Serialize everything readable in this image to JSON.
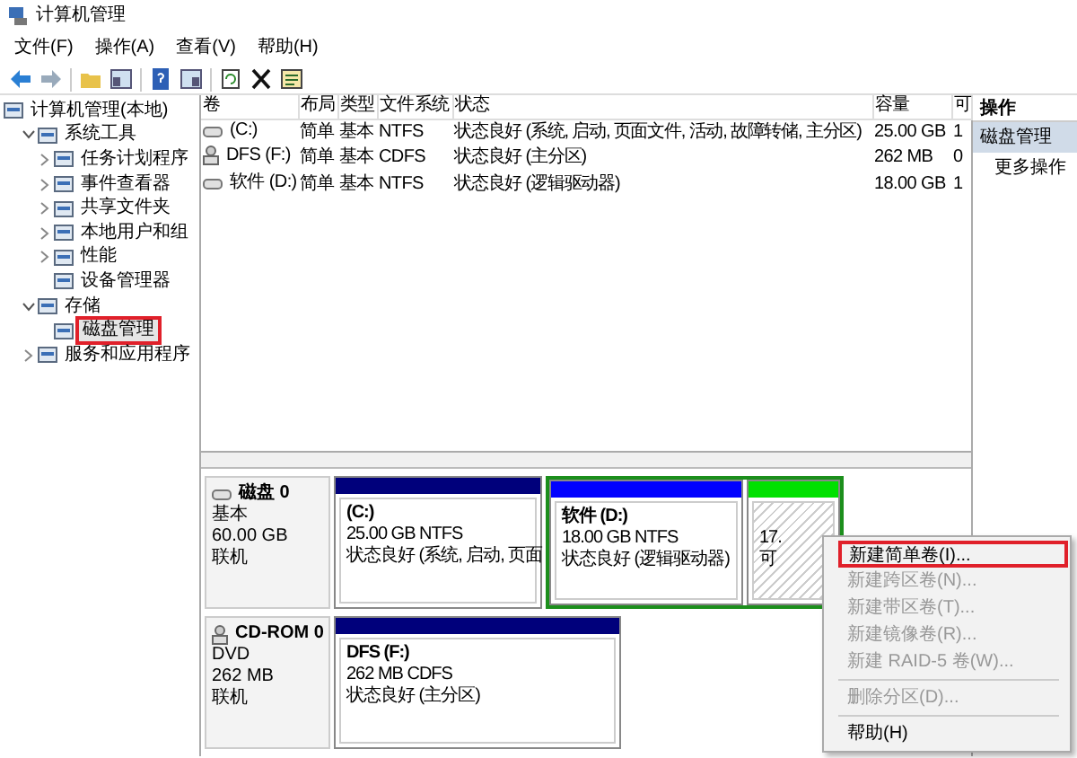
{
  "window": {
    "title": "计算机管理"
  },
  "menu": [
    "文件(F)",
    "操作(A)",
    "查看(V)",
    "帮助(H)"
  ],
  "tree": [
    {
      "label": "计算机管理(本地)",
      "selected": false,
      "highlighted": false,
      "children": [
        {
          "label": "系统工具",
          "expanded": true,
          "selected": false,
          "highlighted": false,
          "children": [
            {
              "label": "任务计划程序",
              "expanded": false,
              "selected": false,
              "highlighted": false
            },
            {
              "label": "事件查看器",
              "expanded": false,
              "selected": false,
              "highlighted": false
            },
            {
              "label": "共享文件夹",
              "expanded": false,
              "selected": false,
              "highlighted": false
            },
            {
              "label": "本地用户和组",
              "expanded": false,
              "selected": false,
              "highlighted": false
            },
            {
              "label": "性能",
              "expanded": false,
              "selected": false,
              "highlighted": false
            },
            {
              "label": "设备管理器",
              "selected": false,
              "highlighted": false
            }
          ]
        },
        {
          "label": "存储",
          "expanded": true,
          "selected": false,
          "highlighted": false,
          "children": [
            {
              "label": "磁盘管理",
              "selected": true,
              "highlighted": true
            }
          ]
        },
        {
          "label": "服务和应用程序",
          "expanded": false,
          "selected": false,
          "highlighted": false
        }
      ]
    }
  ],
  "table": {
    "columns": [
      "卷",
      "布局",
      "类型",
      "文件系统",
      "状态",
      "容量",
      "可"
    ],
    "rows": [
      {
        "kind": "hdd",
        "cells": [
          "(C:)",
          "简单",
          "基本",
          "NTFS",
          "状态良好 (系统, 启动, 页面文件, 活动, 故障转储, 主分区)",
          "25.00 GB",
          "1"
        ]
      },
      {
        "kind": "cdrom",
        "cells": [
          "DFS (F:)",
          "简单",
          "基本",
          "CDFS",
          "状态良好 (主分区)",
          "262 MB",
          "0"
        ]
      },
      {
        "kind": "hdd",
        "cells": [
          "软件 (D:)",
          "简单",
          "基本",
          "NTFS",
          "状态良好 (逻辑驱动器)",
          "18.00 GB",
          "1"
        ]
      }
    ]
  },
  "disks": [
    {
      "kind": "hdd",
      "name": "磁盘 0",
      "lines": [
        "基本",
        "60.00 GB",
        "联机"
      ],
      "partitions": [
        {
          "kind": "primary",
          "color": "#00007b",
          "name": "(C:)",
          "lines": [
            "25.00 GB NTFS",
            "状态良好 (系统, 启动, 页面"
          ]
        },
        {
          "kind": "extended",
          "selected": true,
          "children": [
            {
              "kind": "logical",
              "color": "#0000ff",
              "name": "软件  (D:)",
              "lines": [
                "18.00 GB NTFS",
                "状态良好 (逻辑驱动器)"
              ]
            },
            {
              "kind": "free",
              "color": "#00e000",
              "lines": [
                "17.",
                "可"
              ]
            }
          ]
        }
      ]
    },
    {
      "kind": "cdrom",
      "name": "CD-ROM 0",
      "lines": [
        "DVD",
        "262 MB",
        "联机"
      ],
      "partitions": [
        {
          "kind": "primary",
          "color": "#00007b",
          "name": "DFS  (F:)",
          "lines": [
            "262 MB CDFS",
            "状态良好 (主分区)"
          ]
        }
      ]
    }
  ],
  "actions": {
    "header": "操作",
    "items": [
      {
        "label": "磁盘管理",
        "selected": true
      },
      {
        "label": "更多操作",
        "selected": false
      }
    ]
  },
  "context_menu": [
    {
      "kind": "item",
      "label": "新建简单卷(I)...",
      "disabled": false,
      "highlighted": true
    },
    {
      "kind": "item",
      "label": "新建跨区卷(N)...",
      "disabled": true,
      "highlighted": false
    },
    {
      "kind": "item",
      "label": "新建带区卷(T)...",
      "disabled": true,
      "highlighted": false
    },
    {
      "kind": "item",
      "label": "新建镜像卷(R)...",
      "disabled": true,
      "highlighted": false
    },
    {
      "kind": "item",
      "label": "新建 RAID-5 卷(W)...",
      "disabled": true,
      "highlighted": false
    },
    {
      "kind": "separator"
    },
    {
      "kind": "item",
      "label": "删除分区(D)...",
      "disabled": true,
      "highlighted": false
    },
    {
      "kind": "separator"
    },
    {
      "kind": "item",
      "label": "帮助(H)",
      "disabled": false,
      "highlighted": false
    }
  ]
}
